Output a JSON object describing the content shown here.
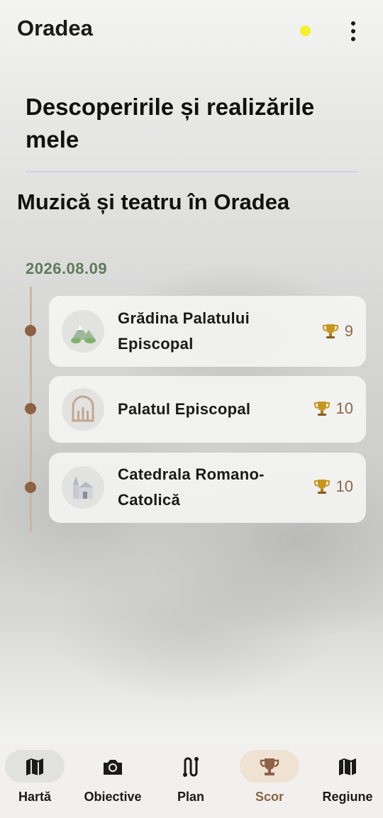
{
  "app": {
    "title": "Oradea"
  },
  "page": {
    "heading": "Descoperirile și realizările mele",
    "section_title": "Muzică și teatru în Oradea",
    "date": "2026.08.09"
  },
  "achievements": [
    {
      "name": "Grădina Palatului Episcopal",
      "score": "9",
      "icon": "mountain-icon"
    },
    {
      "name": "Palatul Episcopal",
      "score": "10",
      "icon": "arch-building-icon"
    },
    {
      "name": "Catedrala Romano-Catolică",
      "score": "10",
      "icon": "church-icon"
    }
  ],
  "nav": {
    "items": [
      {
        "label": "Hartă",
        "icon": "map-icon",
        "active_pill": true
      },
      {
        "label": "Obiective",
        "icon": "camera-icon"
      },
      {
        "label": "Plan",
        "icon": "route-icon"
      },
      {
        "label": "Scor",
        "icon": "trophy-icon",
        "selected": true
      },
      {
        "label": "Regiune",
        "icon": "map-icon"
      }
    ]
  },
  "colors": {
    "accent_brown": "#8c6243",
    "date_green": "#5f7a5c",
    "status_yellow": "#f4f02c",
    "trophy_gold": "#c8961e"
  }
}
